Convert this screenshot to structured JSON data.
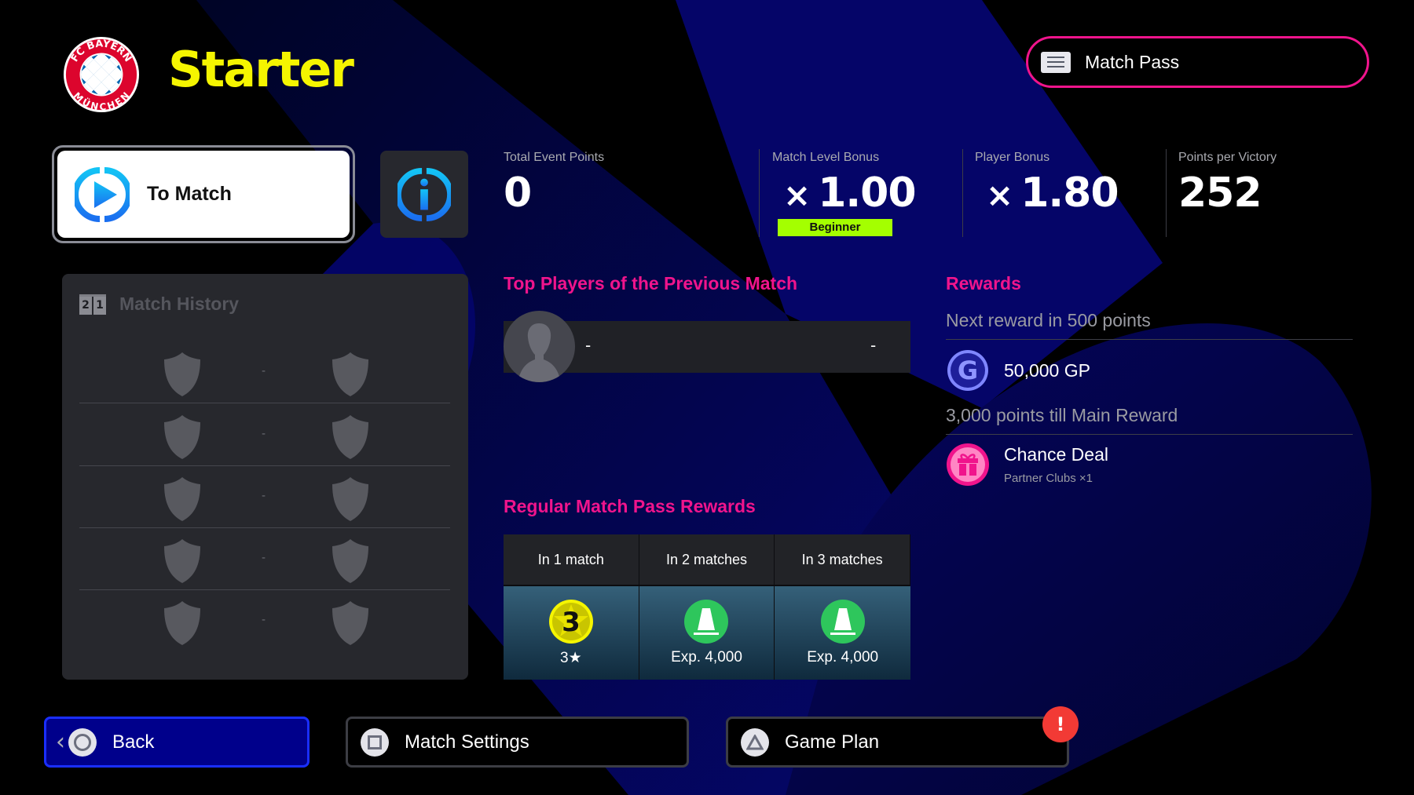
{
  "header": {
    "club_logo": "fc-bayern-munchen-crest",
    "club_logo_text_top": "FC BAYERN",
    "club_logo_text_bottom": "MÜNCHEN",
    "title": "Starter",
    "match_pass_label": "Match Pass",
    "match_pass_icon": "menu-icon"
  },
  "actions": {
    "to_match_label": "To Match",
    "to_match_icon": "play-icon",
    "info_icon": "info-icon"
  },
  "stats": [
    {
      "label": "Total Event Points",
      "multiplier": "",
      "value": "0"
    },
    {
      "label": "Match Level Bonus",
      "multiplier": "×",
      "value": "1.00",
      "badge": "Beginner"
    },
    {
      "label": "Player Bonus",
      "multiplier": "×",
      "value": "1.80"
    },
    {
      "label": "Points per Victory",
      "multiplier": "",
      "value": "252"
    }
  ],
  "match_history": {
    "title": "Match History",
    "icon_digits": [
      "2",
      "1"
    ],
    "rows": [
      {
        "score": "-"
      },
      {
        "score": "-"
      },
      {
        "score": "-"
      },
      {
        "score": "-"
      },
      {
        "score": "-"
      }
    ]
  },
  "top_players": {
    "heading": "Top Players of the Previous Match",
    "player_name": "-",
    "player_score": "-"
  },
  "rewards": {
    "heading": "Rewards",
    "next_reward_text": "Next reward in 500 points",
    "next_reward": {
      "name": "50,000 GP",
      "icon": "gp-coin-icon"
    },
    "main_reward_text": "3,000 points till Main Reward",
    "main_reward": {
      "name": "Chance Deal",
      "sub": "Partner Clubs ×1",
      "icon": "gift-icon"
    }
  },
  "regular_rewards": {
    "heading": "Regular Match Pass Rewards",
    "columns": [
      {
        "header": "In 1 match",
        "icon": "star-badge-icon",
        "icon_text": "3",
        "label": "3★"
      },
      {
        "header": "In 2 matches",
        "icon": "training-cone-icon",
        "label": "Exp. 4,000"
      },
      {
        "header": "In 3 matches",
        "icon": "training-cone-icon",
        "label": "Exp. 4,000"
      }
    ]
  },
  "footer": {
    "back_label": "Back",
    "match_settings_label": "Match Settings",
    "game_plan_label": "Game Plan",
    "game_plan_alert": "!"
  },
  "colors": {
    "accent_pink": "#f0148c",
    "title_yellow": "#f5f500",
    "beginner_green": "#a4ff00",
    "back_blue": "#00008b",
    "alert_red": "#f23a35"
  }
}
